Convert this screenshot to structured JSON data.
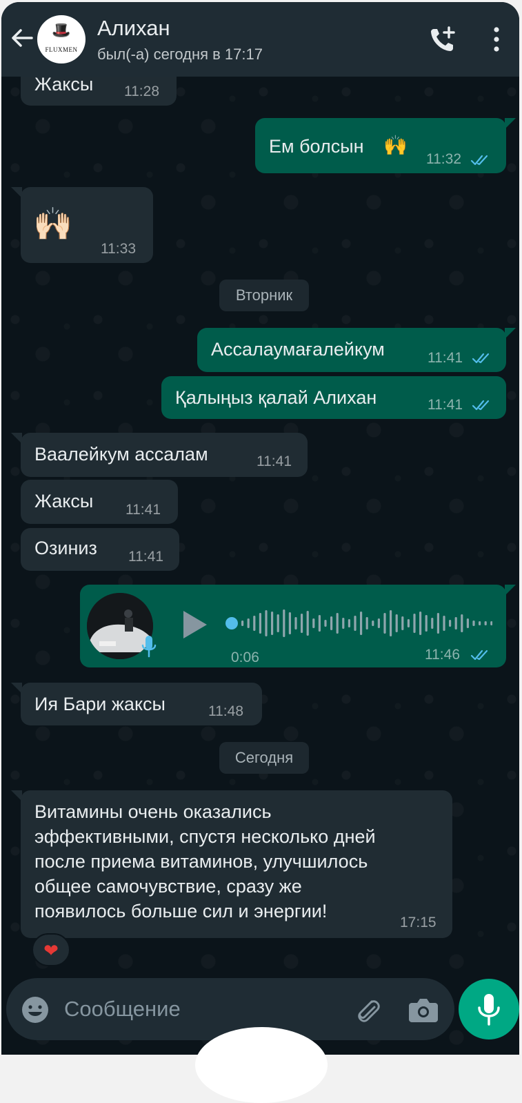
{
  "header": {
    "contact_name": "Алихан",
    "status": "был(-а) сегодня в 17:17",
    "avatar_brand": "FLUXMEN"
  },
  "messages": [
    {
      "dir": "in",
      "text": "Жаксы",
      "time": "11:28"
    },
    {
      "dir": "out",
      "text": "Ем болсын",
      "emoji": "🙌",
      "time": "11:32",
      "read": true
    },
    {
      "dir": "in",
      "emoji": "🙌🏻",
      "time": "11:33"
    },
    {
      "day_separator": "Вторник"
    },
    {
      "dir": "out",
      "text": "Ассалаумағалейкум",
      "time": "11:41",
      "read": true
    },
    {
      "dir": "out",
      "text": "Қалыңыз қалай Алихан",
      "time": "11:41",
      "read": true
    },
    {
      "dir": "in",
      "text": "Ваалейкум ассалам",
      "time": "11:41"
    },
    {
      "dir": "in",
      "text": "Жаксы",
      "time": "11:41"
    },
    {
      "dir": "in",
      "text": "Озиниз",
      "time": "11:41"
    },
    {
      "dir": "out",
      "type": "voice",
      "duration": "0:06",
      "time": "11:46",
      "read": true
    },
    {
      "dir": "in",
      "text": "Ия Бари жаксы",
      "time": "11:48"
    },
    {
      "day_separator": "Сегодня"
    },
    {
      "dir": "in",
      "lines": [
        "Витамины очень оказались",
        "эффективными, спустя несколько дней",
        "после приема витаминов, улучшилось",
        "общее самочувствие, сразу же",
        "появилось больше сил и энергии!"
      ],
      "time": "17:15",
      "reaction": "❤"
    }
  ],
  "input": {
    "placeholder": "Сообщение"
  },
  "colors": {
    "background": "#0b141a",
    "header": "#1f2c34",
    "incoming_bubble": "#202c33",
    "outgoing_bubble": "#005c4b",
    "accent": "#00a884",
    "read_ticks": "#53bdeb"
  },
  "icons": [
    "back-arrow-icon",
    "add-call-icon",
    "more-vert-icon",
    "play-icon",
    "mic-icon",
    "emoji-icon",
    "attach-icon",
    "camera-icon"
  ]
}
